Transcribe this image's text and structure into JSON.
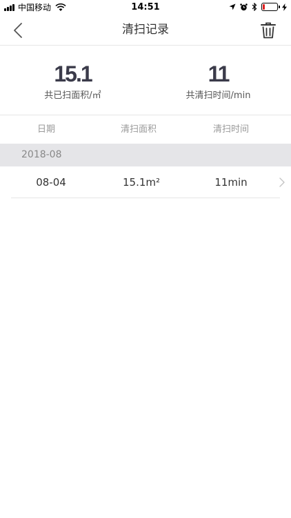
{
  "status_bar": {
    "carrier": "中国移动",
    "time": "14:51"
  },
  "nav": {
    "title": "清扫记录"
  },
  "summary": {
    "area_value": "15.1",
    "area_label": "共已扫面积/㎡",
    "time_value": "11",
    "time_label": "共清扫时间/min"
  },
  "table": {
    "headers": [
      "日期",
      "清扫面积",
      "清扫时间"
    ],
    "sections": [
      {
        "month": "2018-08",
        "rows": [
          {
            "date": "08-04",
            "area": "15.1m²",
            "duration": "11min"
          }
        ]
      }
    ]
  },
  "colors": {
    "stat_value": "#3b3b4a",
    "section_bg": "#e5e5e8",
    "battery_low": "#e02020"
  },
  "icons": [
    "back-chevron-icon",
    "trash-icon",
    "row-chevron-icon",
    "wifi-icon",
    "location-icon",
    "alarm-icon",
    "bluetooth-icon",
    "battery-icon",
    "charging-icon"
  ]
}
